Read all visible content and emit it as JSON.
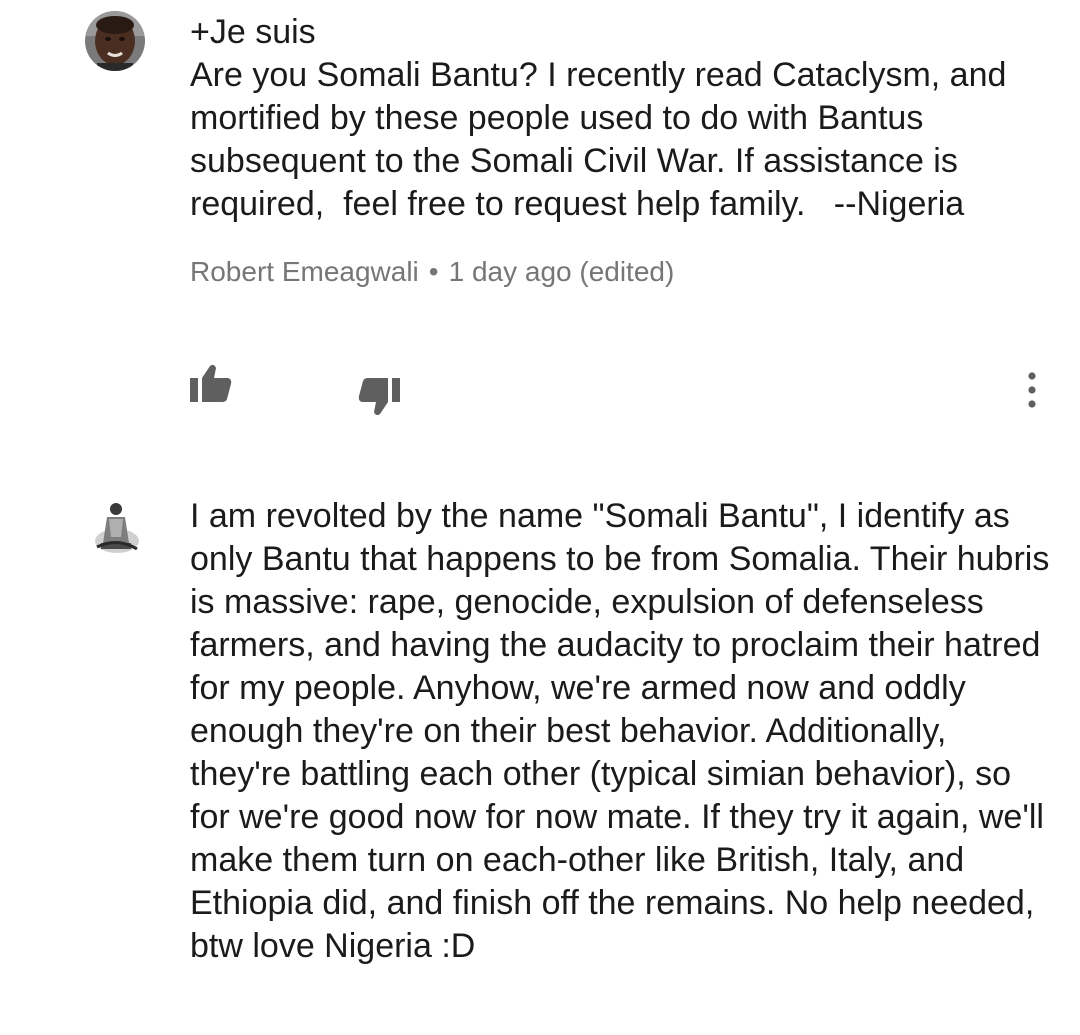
{
  "comments": [
    {
      "text": "+Je suis\nAre you Somali Bantu? I recently read Cataclysm, and mortified by these people used to do with Bantus subsequent to the Somali Civil War. If assistance is required,  feel free to request help family.   --Nigeria",
      "author": "Robert Emeagwali",
      "separator": "•",
      "time": "1 day ago (edited)"
    },
    {
      "text": "I am revolted by the name \"Somali Bantu\", I identify as only Bantu that happens to be from Somalia. Their hubris is massive: rape, genocide, expulsion of defenseless farmers, and having the audacity to proclaim their hatred for my people. Anyhow, we're armed now and oddly enough they're on their best behavior. Additionally, they're battling each other (typical simian behavior), so for we're good now for now mate. If they try it again, we'll make them turn on each-other like British, Italy, and Ethiopia did, and finish off the remains. No help needed, btw love Nigeria :D"
    }
  ],
  "icons": {
    "like": "thumbs-up-icon",
    "dislike": "thumbs-down-icon",
    "more": "more-vertical-icon"
  },
  "colors": {
    "icon": "#5f5f5f",
    "meta_text": "#767676"
  }
}
